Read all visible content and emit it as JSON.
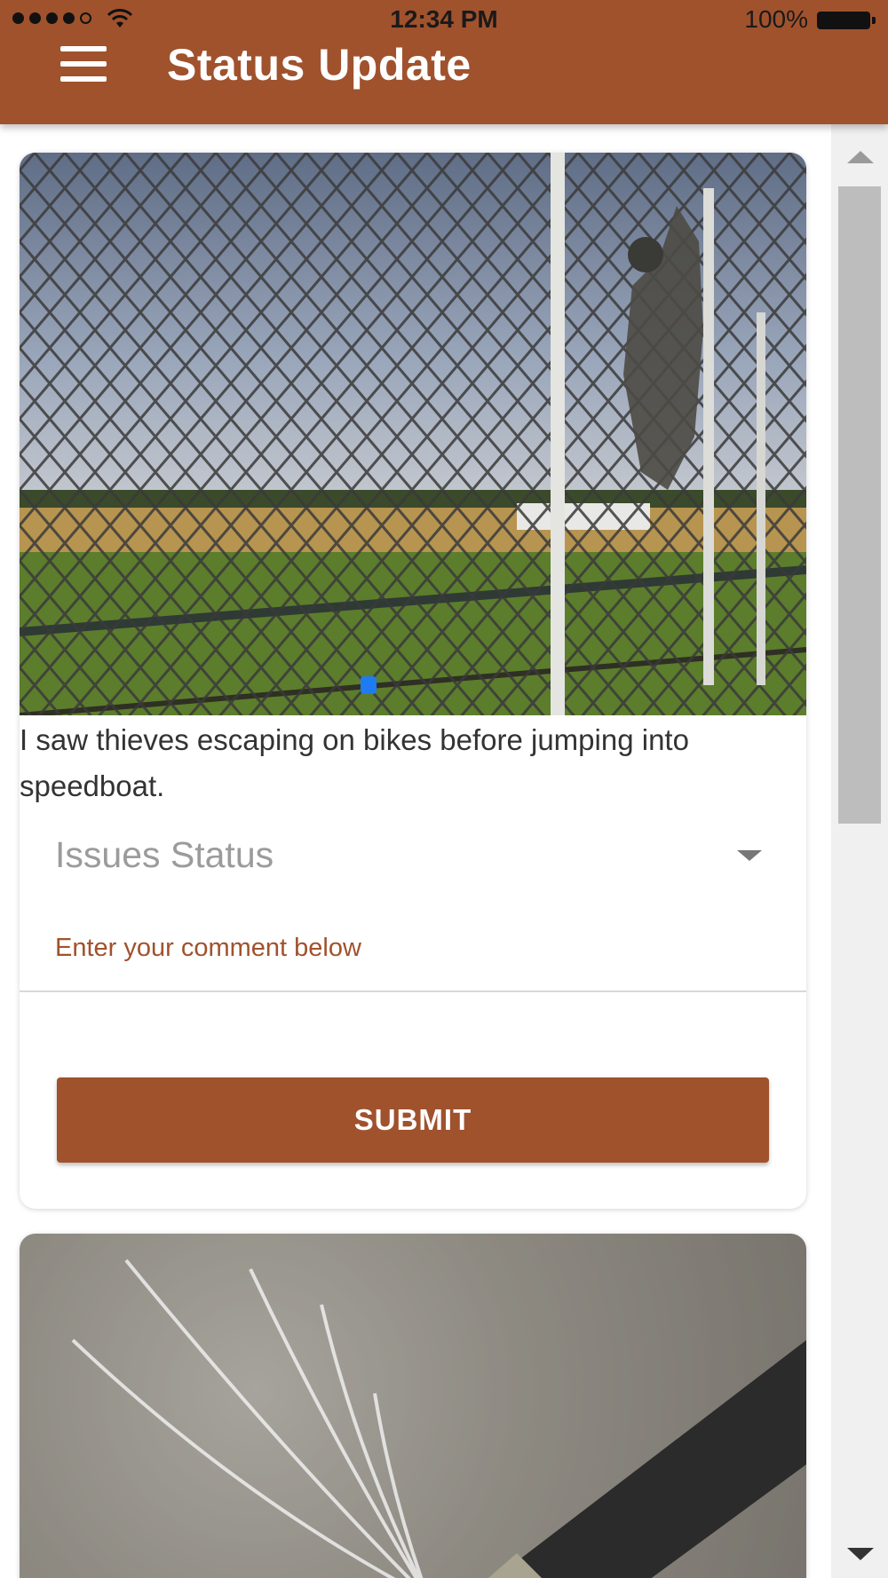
{
  "statusbar": {
    "time": "12:34 PM",
    "battery": "100%",
    "signal_icon": "signal-dots-icon",
    "wifi_icon": "wifi-icon",
    "battery_icon": "battery-icon"
  },
  "appbar": {
    "title": "Status Update",
    "menu_icon": "hamburger-menu-icon",
    "color": "#A0522D"
  },
  "cards": [
    {
      "image": "fence-intruder-photo",
      "carousel_active_index": 1,
      "description": "I saw thieves escaping on bikes before jumping into speedboat.",
      "status_select": {
        "placeholder": "Issues Status"
      },
      "comment": {
        "label": "Enter your comment below",
        "value": ""
      },
      "submit_label": "SUBMIT"
    },
    {
      "image": "leaking-pipe-photo"
    }
  ],
  "theme": {
    "accent": "#A0522D",
    "carousel_dot": "#1E7BF2"
  }
}
